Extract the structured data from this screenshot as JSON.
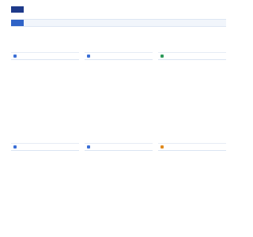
{
  "site": {
    "logo_text": ""
  },
  "nav": {
    "items": [
      {
        "label": "",
        "active": true
      },
      {
        "label": ""
      },
      {
        "label": ""
      },
      {
        "label": ""
      },
      {
        "label": ""
      },
      {
        "label": ""
      },
      {
        "label": ""
      },
      {
        "label": ""
      },
      {
        "label": ""
      },
      {
        "label": ""
      },
      {
        "label": ""
      }
    ]
  },
  "panels": [
    {
      "title": "",
      "icon": "document-icon",
      "icon_color": "#3b6fd6",
      "links": [
        "",
        "",
        "",
        "",
        "",
        "",
        "",
        "",
        "",
        "",
        "",
        "",
        "",
        "",
        "",
        "",
        ""
      ]
    },
    {
      "title": "",
      "icon": "document-icon",
      "icon_color": "#3b6fd6",
      "links": [
        "",
        "",
        "",
        "",
        "",
        "",
        "",
        "",
        "",
        "",
        "",
        "",
        "",
        "",
        "",
        "",
        ""
      ]
    },
    {
      "title": "",
      "icon": "document-icon",
      "icon_color": "#2e9a5b",
      "links": [
        "",
        "",
        "",
        "",
        "",
        "",
        "",
        "",
        "",
        "",
        "",
        "",
        "",
        "",
        "",
        "",
        ""
      ]
    },
    {
      "title": "",
      "icon": "document-icon",
      "icon_color": "#3b6fd6",
      "links": [
        "",
        "",
        "",
        "",
        "",
        "",
        "",
        "",
        "",
        "",
        "",
        "",
        "",
        "",
        "",
        "",
        "",
        "",
        "",
        ""
      ]
    },
    {
      "title": "",
      "icon": "document-icon",
      "icon_color": "#3b6fd6",
      "links": [
        "",
        "",
        "",
        "",
        "",
        "",
        "",
        "",
        "",
        "",
        "",
        "",
        "",
        "",
        "",
        "",
        "",
        "",
        "",
        ""
      ]
    },
    {
      "title": "",
      "icon": "document-icon",
      "icon_color": "#e08a1e",
      "links": [
        "",
        "",
        "",
        "",
        "",
        "",
        "",
        "",
        "",
        "",
        "",
        "",
        "",
        "",
        "",
        "",
        "",
        "",
        "",
        ""
      ]
    }
  ],
  "colors": {
    "brand": "#1e3a8a",
    "nav_active": "#2f63c7",
    "panel_title": "#3a62b8",
    "link": "#5a6c8f"
  }
}
